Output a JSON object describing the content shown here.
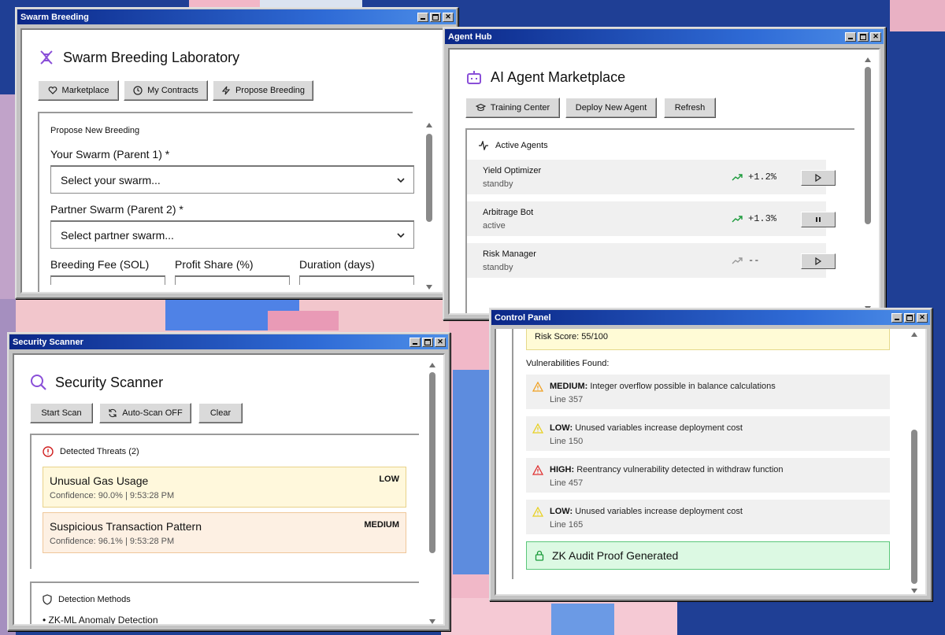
{
  "colors": {
    "desktop": "#1f3f95",
    "accent_purple": "#8a4fd8",
    "title_gradient_start": "#0b2787",
    "title_gradient_end": "#4e8fe8",
    "threat_low_bg": "#fff8dc",
    "threat_medium_bg": "#fdf0e3",
    "zk_bg": "#dcf9e3",
    "risk_bg": "#fffbd6"
  },
  "swarm_window": {
    "title": "Swarm Breeding",
    "app_title": "Swarm Breeding Laboratory",
    "icon": "dna-icon",
    "buttons": [
      "Marketplace",
      "My Contracts",
      "Propose Breeding"
    ],
    "section_title": "Propose New Breeding",
    "parent1_label": "Your Swarm (Parent 1) *",
    "parent1_value": "Select your swarm...",
    "parent2_label": "Partner Swarm (Parent 2) *",
    "parent2_value": "Select partner swarm...",
    "fee_label": "Breeding Fee (SOL)",
    "profit_label": "Profit Share (%)",
    "duration_label": "Duration (days)"
  },
  "agent_window": {
    "title": "Agent Hub",
    "app_title": "AI Agent Marketplace",
    "icon": "robot-icon",
    "buttons": [
      "Training Center",
      "Deploy New Agent",
      "Refresh"
    ],
    "section_title": "Active Agents",
    "agents": [
      {
        "name": "Yield Optimizer",
        "status": "standby",
        "perf": "+1.2%",
        "trend": "up",
        "action": "play"
      },
      {
        "name": "Arbitrage Bot",
        "status": "active",
        "perf": "+1.3%",
        "trend": "up",
        "action": "pause"
      },
      {
        "name": "Risk Manager",
        "status": "standby",
        "perf": "--",
        "trend": "flat",
        "action": "play"
      }
    ]
  },
  "security_window": {
    "title": "Security Scanner",
    "app_title": "Security Scanner",
    "icon": "search-icon",
    "buttons": [
      "Start Scan",
      "Auto-Scan OFF",
      "Clear"
    ],
    "threats_title": "Detected Threats (2)",
    "threats": [
      {
        "name": "Unusual Gas Usage",
        "meta": "Confidence: 90.0% | 9:53:28 PM",
        "severity": "LOW"
      },
      {
        "name": "Suspicious Transaction Pattern",
        "meta": "Confidence: 96.1% | 9:53:28 PM",
        "severity": "MEDIUM"
      }
    ],
    "methods_title": "Detection Methods",
    "methods": [
      "ZK-ML Anomaly Detection"
    ]
  },
  "control_window": {
    "title": "Control Panel",
    "risk_score": "Risk Score: 55/100",
    "vuln_title": "Vulnerabilities Found:",
    "vulns": [
      {
        "severity": "MEDIUM:",
        "text": "Integer overflow possible in balance calculations",
        "line": "Line 357",
        "icon": "warning-icon",
        "color": "#f0a020"
      },
      {
        "severity": "LOW:",
        "text": "Unused variables increase deployment cost",
        "line": "Line 150",
        "icon": "warning-icon",
        "color": "#e8d020"
      },
      {
        "severity": "HIGH:",
        "text": "Reentrancy vulnerability detected in withdraw function",
        "line": "Line 457",
        "icon": "warning-icon",
        "color": "#e03030"
      },
      {
        "severity": "LOW:",
        "text": "Unused variables increase deployment cost",
        "line": "Line 165",
        "icon": "warning-icon",
        "color": "#e8d020"
      }
    ],
    "zk_proof": "ZK Audit Proof Generated"
  }
}
